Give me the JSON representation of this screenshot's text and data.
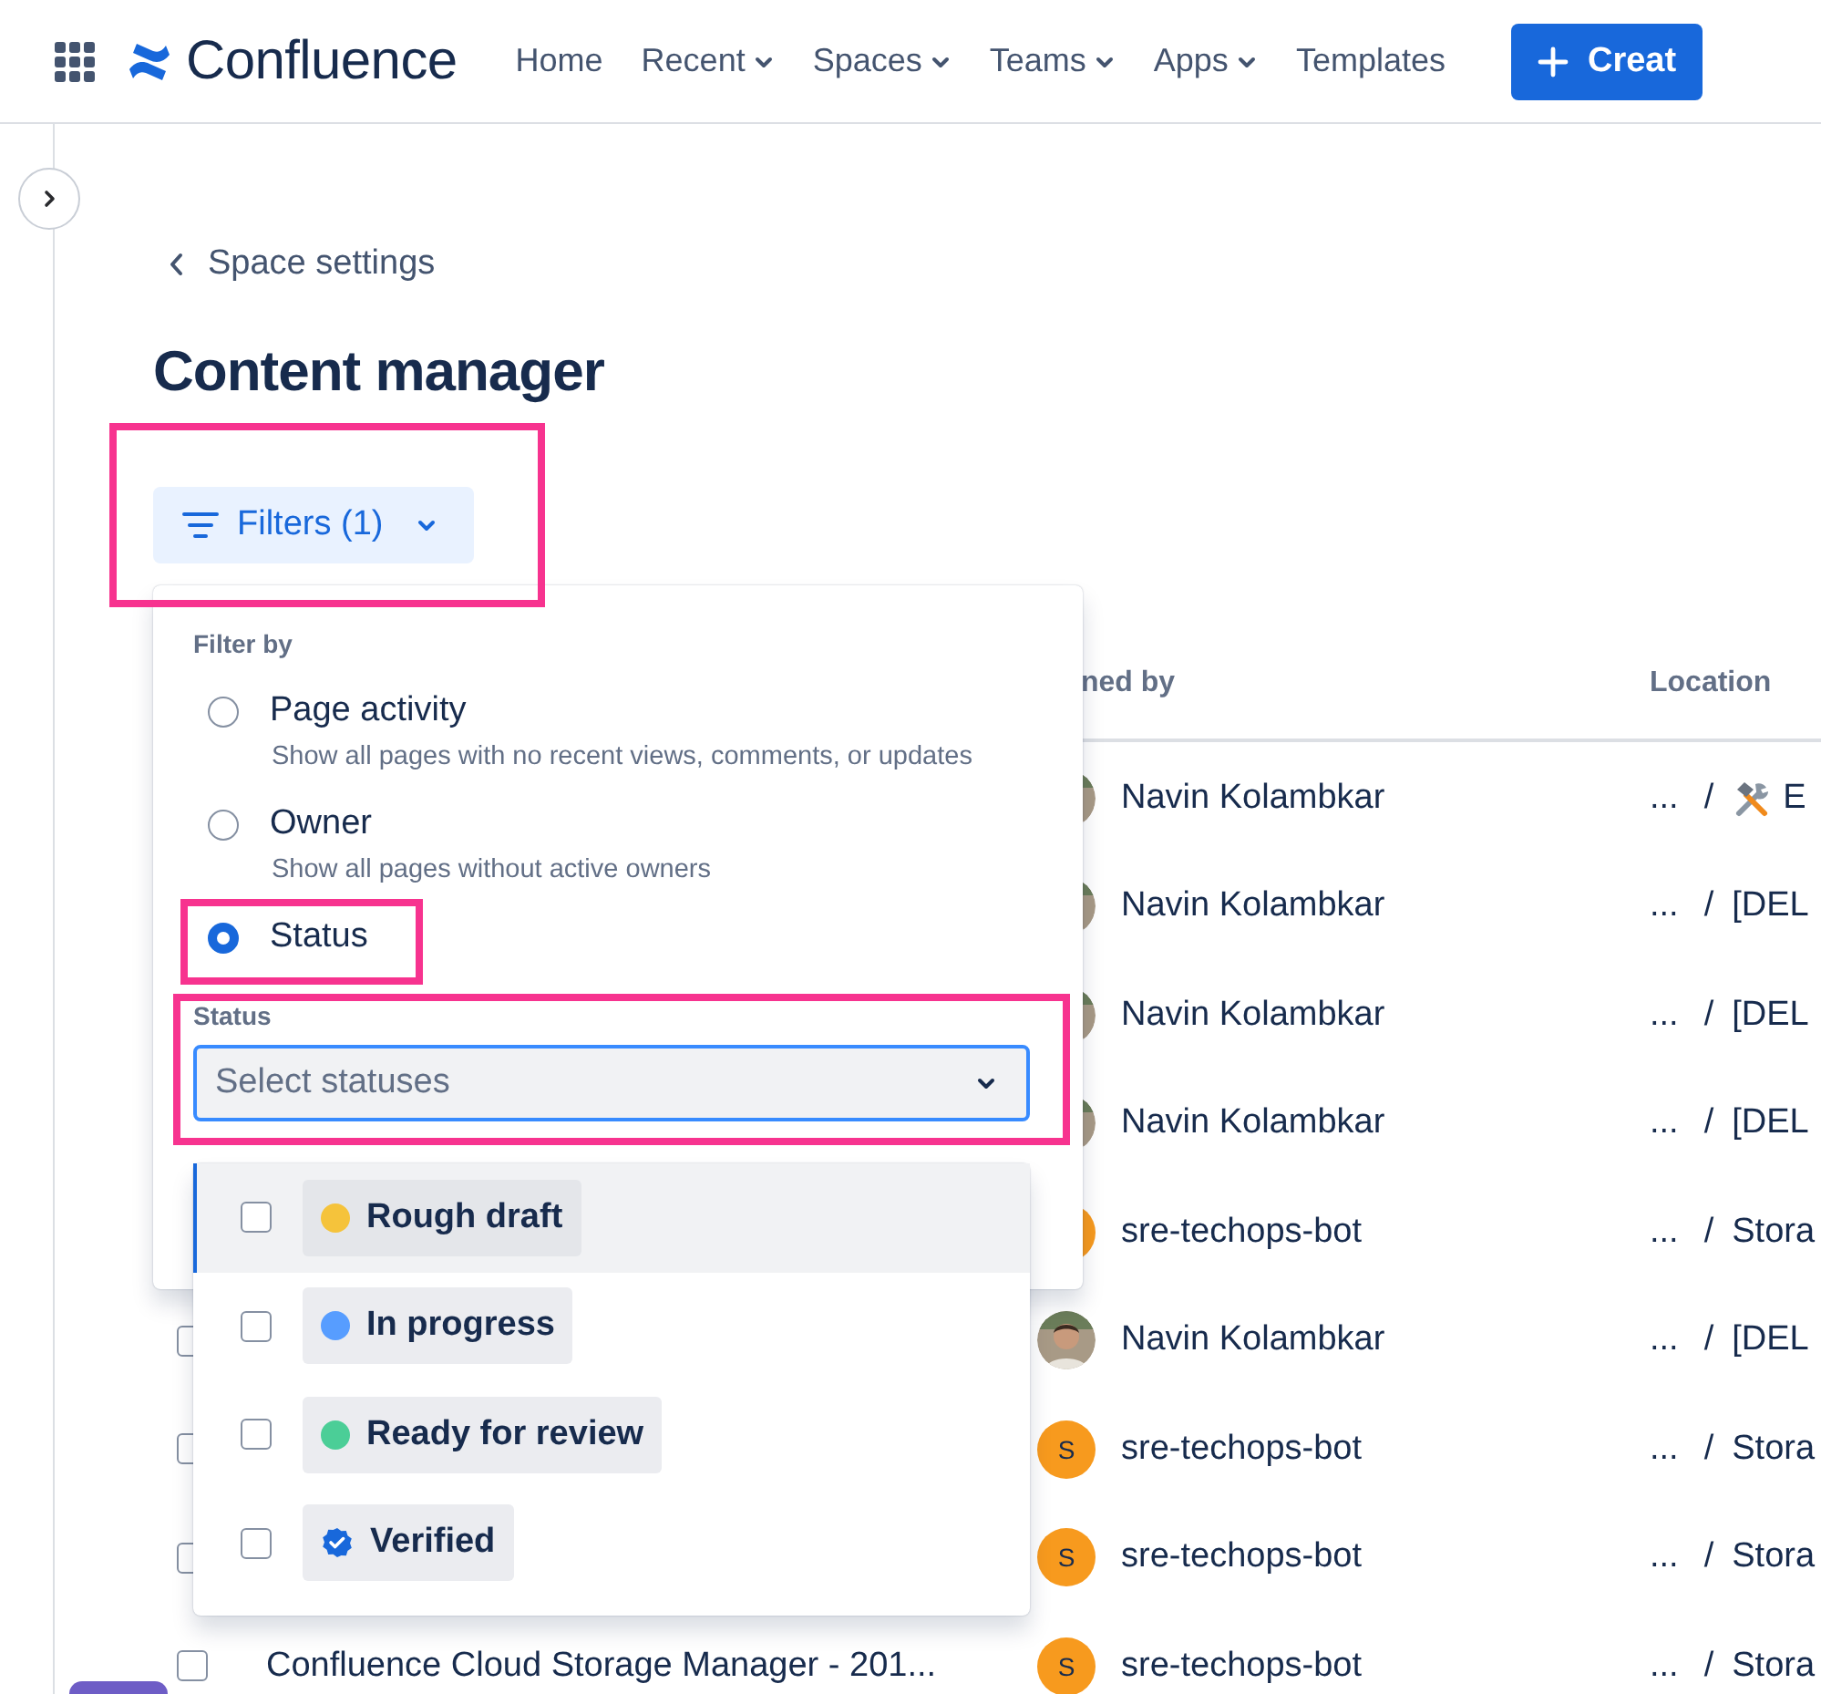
{
  "nav": {
    "product": "Confluence",
    "items": [
      {
        "label": "Home",
        "dropdown": false
      },
      {
        "label": "Recent",
        "dropdown": true
      },
      {
        "label": "Spaces",
        "dropdown": true
      },
      {
        "label": "Teams",
        "dropdown": true
      },
      {
        "label": "Apps",
        "dropdown": true
      },
      {
        "label": "Templates",
        "dropdown": false
      }
    ],
    "create_button": "Creat"
  },
  "back_link": "Space settings",
  "title": "Content manager",
  "filters_button": "Filters (1)",
  "table": {
    "columns": [
      "ned by",
      "Location"
    ],
    "rows": [
      {
        "owner": "Navin Kolambkar",
        "location": {
          "ellipsis": "...",
          "separator": "/",
          "kind": "with_icon",
          "text": "E"
        }
      },
      {
        "owner": "Navin Kolambkar",
        "location": {
          "ellipsis": "...",
          "separator": "/",
          "text": "[DEL"
        }
      },
      {
        "owner": "Navin Kolambkar",
        "location": {
          "ellipsis": "...",
          "separator": "/",
          "text": "[DEL"
        }
      },
      {
        "owner": "Navin Kolambkar",
        "location": {
          "ellipsis": "...",
          "separator": "/",
          "text": "[DEL"
        }
      },
      {
        "owner": "sre-techops-bot",
        "avatar": {
          "kind": "letter"
        },
        "location": {
          "ellipsis": "...",
          "separator": "/",
          "text": "Stora"
        }
      },
      {
        "checked": false,
        "owner": "Navin Kolambkar",
        "location": {
          "ellipsis": "...",
          "separator": "/",
          "text": "[DEL"
        }
      },
      {
        "checked": false,
        "owner": "sre-techops-bot",
        "avatar": {
          "kind": "letter",
          "letter": "S"
        },
        "location": {
          "ellipsis": "...",
          "separator": "/",
          "text": "Stora"
        }
      },
      {
        "checked": false,
        "owner": "sre-techops-bot",
        "avatar": {
          "kind": "letter",
          "letter": "S"
        },
        "location": {
          "ellipsis": "...",
          "separator": "/",
          "text": "Stora"
        }
      },
      {
        "checked": false,
        "title": "Confluence Cloud Storage Manager - 201...",
        "owner": "sre-techops-bot",
        "avatar": {
          "kind": "letter",
          "letter": "S"
        },
        "location": {
          "ellipsis": "...",
          "separator": "/",
          "text": "Stora"
        }
      }
    ]
  },
  "filter_panel": {
    "heading": "Filter by",
    "options": [
      {
        "label": "Page activity",
        "description": "Show all pages with no recent views, comments, or updates",
        "selected": false
      },
      {
        "label": "Owner",
        "description": "Show all pages without active owners",
        "selected": false
      },
      {
        "label": "Status",
        "selected": true
      }
    ],
    "status_field": {
      "label": "Status",
      "placeholder": "Select statuses"
    },
    "status_options": [
      {
        "label": "Rough draft",
        "kind": "dot",
        "color": "#f5c33b",
        "checked": false,
        "selected": true
      },
      {
        "label": "In progress",
        "kind": "dot",
        "color": "#579dff",
        "checked": false,
        "selected": false
      },
      {
        "label": "Ready for review",
        "kind": "dot",
        "color": "#4bce97",
        "checked": false,
        "selected": false
      },
      {
        "label": "Verified",
        "kind": "verified",
        "checked": false,
        "selected": false
      }
    ]
  }
}
